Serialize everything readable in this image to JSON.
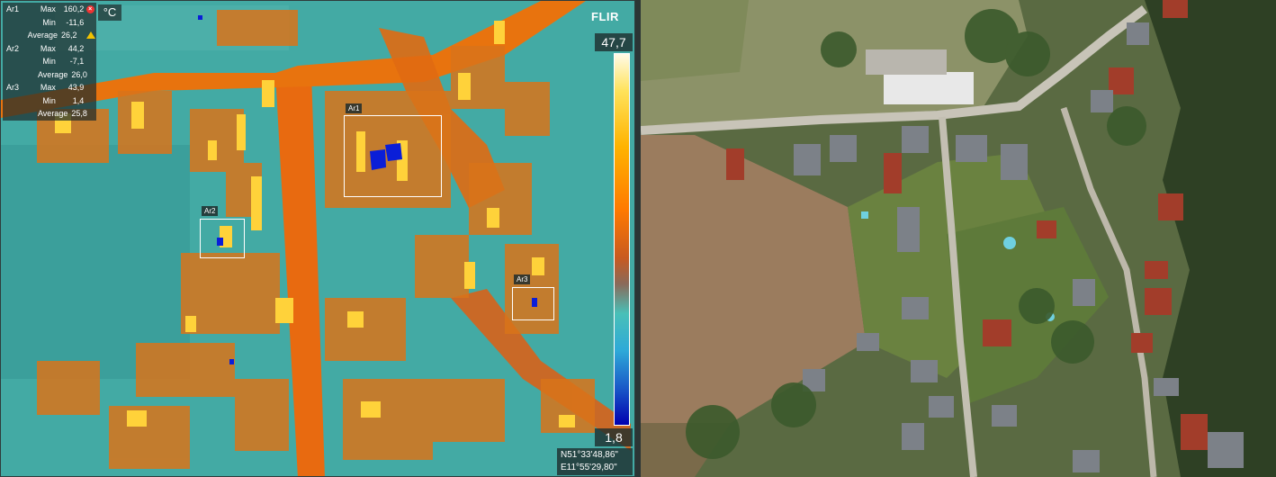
{
  "thermal": {
    "unit": "°C",
    "logo": "FLIR",
    "scale_max": "47,7",
    "scale_min": "1,8",
    "gps_lat": "N51°33'48,86\"",
    "gps_lon": "E11°55'29,80\"",
    "measurements": [
      {
        "area": "Ar1",
        "rows": [
          {
            "label": "Max",
            "value": "160,2",
            "icon": "error-icon"
          },
          {
            "label": "Min",
            "value": "-11,6"
          },
          {
            "label": "Average",
            "value": "26,2",
            "icon": "warning-icon"
          }
        ]
      },
      {
        "area": "Ar2",
        "rows": [
          {
            "label": "Max",
            "value": "44,2"
          },
          {
            "label": "Min",
            "value": "-7,1"
          },
          {
            "label": "Average",
            "value": "26,0"
          }
        ]
      },
      {
        "area": "Ar3",
        "rows": [
          {
            "label": "Max",
            "value": "43,9"
          },
          {
            "label": "Min",
            "value": "1,4"
          },
          {
            "label": "Average",
            "value": "25,8"
          }
        ]
      }
    ],
    "roi_labels": [
      "Ar1",
      "Ar2",
      "Ar3"
    ]
  }
}
